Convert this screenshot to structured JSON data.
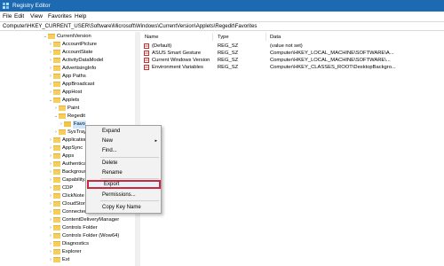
{
  "window": {
    "title": "Registry Editor"
  },
  "menu": [
    "File",
    "Edit",
    "View",
    "Favorites",
    "Help"
  ],
  "address": "Computer\\HKEY_CURRENT_USER\\Software\\Microsoft\\Windows\\CurrentVersion\\Applets\\Regedit\\Favorites",
  "tree": [
    {
      "label": "CurrentVersion",
      "expanded": true
    },
    {
      "label": "AccountPicture",
      "expanded": false
    },
    {
      "label": "AccountState",
      "expanded": false
    },
    {
      "label": "ActivityDataModel",
      "expanded": false
    },
    {
      "label": "AdvertisingInfo",
      "expanded": false
    },
    {
      "label": "App Paths",
      "expanded": false
    },
    {
      "label": "AppBroadcast",
      "expanded": false
    },
    {
      "label": "AppHost",
      "expanded": false
    },
    {
      "label": "Applets",
      "expanded": true
    },
    {
      "label": "Paint",
      "expanded": false
    },
    {
      "label": "Regedit",
      "expanded": true
    },
    {
      "label": "Favo",
      "expanded": false,
      "selected": true
    },
    {
      "label": "SysTray",
      "expanded": false
    },
    {
      "label": "ApplicationF",
      "expanded": false
    },
    {
      "label": "AppSync",
      "expanded": false
    },
    {
      "label": "Apps",
      "expanded": false
    },
    {
      "label": "Authenticati",
      "expanded": false
    },
    {
      "label": "Background",
      "expanded": false
    },
    {
      "label": "CapabilityAc",
      "expanded": false
    },
    {
      "label": "CDP",
      "expanded": false
    },
    {
      "label": "ClickNote",
      "expanded": false
    },
    {
      "label": "CloudStore",
      "expanded": false
    },
    {
      "label": "ConnectedSe",
      "expanded": false
    },
    {
      "label": "ContentDeliveryManager",
      "expanded": false
    },
    {
      "label": "Controls Folder",
      "expanded": false
    },
    {
      "label": "Controls Folder (Wow64)",
      "expanded": false
    },
    {
      "label": "Diagnostics",
      "expanded": false
    },
    {
      "label": "Explorer",
      "expanded": false
    },
    {
      "label": "Ext",
      "expanded": false
    }
  ],
  "list": {
    "headers": {
      "name": "Name",
      "type": "Type",
      "data": "Data"
    },
    "rows": [
      {
        "name": "(Default)",
        "type": "REG_SZ",
        "data": "(value not set)"
      },
      {
        "name": "ASUS Smart Gesture",
        "type": "REG_SZ",
        "data": "Computer\\HKEY_LOCAL_MACHINE\\SOFTWARE\\A..."
      },
      {
        "name": "Current Windows Version",
        "type": "REG_SZ",
        "data": "Computer\\HKEY_LOCAL_MACHINE\\SOFTWARE\\..."
      },
      {
        "name": "Environment Variables",
        "type": "REG_SZ",
        "data": "Computer\\HKEY_CLASSES_ROOT\\DesktopBackgro..."
      }
    ]
  },
  "context_menu": {
    "expand": "Expand",
    "new": "New",
    "find": "Find...",
    "delete": "Delete",
    "rename": "Rename",
    "export": "Export",
    "permissions": "Permissions...",
    "copy_key_name": "Copy Key Name"
  },
  "colors": {
    "titlebar": "#1e6ab2",
    "export_highlight": "#d0283a",
    "folder": "#f7ce5b"
  }
}
